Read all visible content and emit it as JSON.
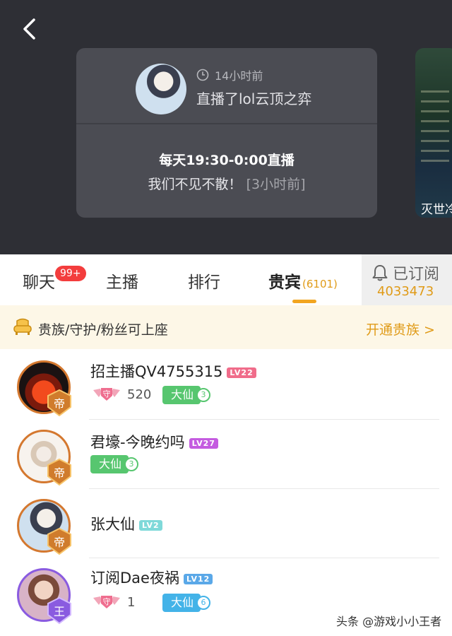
{
  "header": {
    "time_ago": "14小时前",
    "title": "直播了lol云顶之弈",
    "schedule": "每天19:30-0:00直播",
    "message": "我们不见不散！",
    "message_ago": "[3小时前]",
    "side_caption": "灭世冷"
  },
  "tabs": {
    "chat": "聊天",
    "chat_badge": "99+",
    "host": "主播",
    "rank": "排行",
    "vip": "贵宾",
    "vip_count": "(6101)",
    "subscribed": "已订阅",
    "subscribers": "4033473"
  },
  "noble": {
    "text": "贵族/守护/粉丝可上座",
    "link": "开通贵族 >"
  },
  "colors": {
    "accent": "#e09b18",
    "dark_bg": "#2e2f35",
    "badge_red": "#f33d3d"
  },
  "users": [
    {
      "name": "招主播QV4755315",
      "level": "LV22",
      "level_color": "#f06c8a",
      "rank": "帝",
      "guard_count": "520",
      "tag": "大仙",
      "tag_num": "3"
    },
    {
      "name": "君壕-今晚约吗",
      "level": "LV27",
      "level_color": "#c45be0",
      "rank": "帝",
      "tag": "大仙",
      "tag_num": "3"
    },
    {
      "name": "张大仙",
      "level": "LV2",
      "level_color": "#7fd9d9",
      "rank": "帝"
    },
    {
      "name": "订阅Dae夜祸",
      "level": "LV12",
      "level_color": "#5aa8e8",
      "rank": "王",
      "guard_count": "1",
      "tag": "大仙",
      "tag_num": "6"
    }
  ],
  "watermark": "头条 @游戏小小王者"
}
